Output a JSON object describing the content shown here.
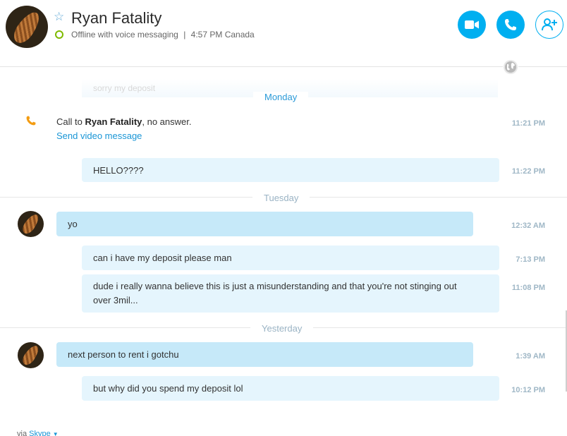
{
  "header": {
    "contact_name": "Ryan Fatality",
    "status": "Offline with voice messaging",
    "separator": "|",
    "local_time": "4:57 PM Canada",
    "star_icon": "star-outline-icon",
    "status_icon": "offline-status-ring",
    "buttons": {
      "video_call": "video-camera-icon",
      "voice_call": "phone-icon",
      "add_people": "add-person-icon"
    }
  },
  "colors": {
    "accent": "#00aff0",
    "bubble_sent": "#e5f5fd",
    "bubble_received": "#c6e9f9",
    "status_ring": "#7fba00",
    "missed_call": "#f39c12"
  },
  "chat": {
    "faded_message": "sorry my deposit",
    "days": {
      "monday": "Monday",
      "tuesday": "Tuesday",
      "yesterday": "Yesterday"
    },
    "call": {
      "prefix": "Call to ",
      "name": "Ryan Fatality",
      "suffix": ", no answer.",
      "time": "11:21 PM",
      "link": "Send video message"
    },
    "messages": [
      {
        "text": "HELLO????",
        "time": "11:22 PM",
        "from": "me"
      },
      {
        "text": "yo",
        "time": "12:32 AM",
        "from": "them"
      },
      {
        "text": "can i have my deposit please man",
        "time": "7:13 PM",
        "from": "me"
      },
      {
        "text_line1": "dude i really wanna believe this is just a misunderstanding and that you're not stinging out",
        "text_line2": "over 3mil...",
        "time": "11:08 PM",
        "from": "me"
      },
      {
        "text": "next person to rent i gotchu",
        "time": "1:39 AM",
        "from": "them"
      },
      {
        "text": "but why did you spend my deposit lol",
        "time": "10:12 PM",
        "from": "me"
      }
    ]
  },
  "footer": {
    "via": "via ",
    "skype": "Skype",
    "dropdown_icon": "caret-down-icon"
  }
}
